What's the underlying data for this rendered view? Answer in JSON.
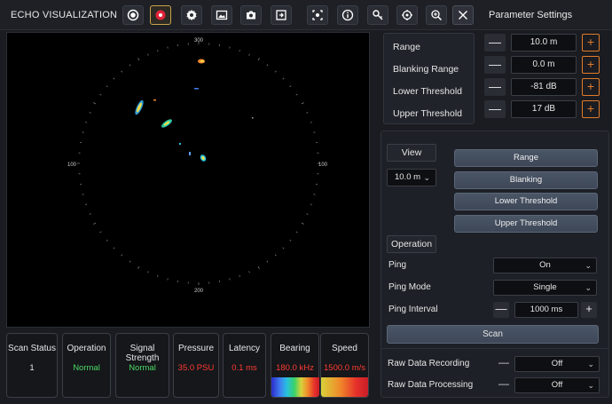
{
  "app": {
    "title": "ECHO VISUALIZATION",
    "parameter_settings_title": "Parameter Settings"
  },
  "toolbar": {
    "icons": [
      "record-circle-icon",
      "record-active-icon",
      "settings-icon",
      "image-icon",
      "camera-icon",
      "export-icon",
      "focus-icon",
      "info-icon",
      "key-icon",
      "target-icon",
      "zoom-icon",
      "close-icon"
    ]
  },
  "radar": {
    "label_top": "300",
    "label_bottom": "200",
    "label_left": "100",
    "label_right": "100"
  },
  "status": {
    "scan_status": {
      "label": "Scan Status",
      "value": "1"
    },
    "operation": {
      "label": "Operation",
      "value": "Normal"
    },
    "signal_strength": {
      "label": "Signal Strength",
      "value": "Normal"
    },
    "pressure": {
      "label": "Pressure",
      "value": "35.0 PSU"
    },
    "latency": {
      "label": "Latency",
      "value": "0.1 ms"
    },
    "bearing": {
      "label": "Bearing",
      "value": "180.0 kHz"
    },
    "speed": {
      "label": "Speed",
      "value": "1500.0 m/s"
    }
  },
  "params": {
    "range": {
      "label": "Range",
      "value": "10.0 m"
    },
    "blanking_range": {
      "label": "Blanking Range",
      "value": "0.0 m"
    },
    "lower_threshold": {
      "label": "Lower Threshold",
      "value": "-81 dB"
    },
    "upper_threshold": {
      "label": "Upper Threshold",
      "value": "17 dB"
    },
    "minus": "—",
    "plus": "+"
  },
  "view": {
    "label": "View",
    "selected": "10.0 m",
    "buttons": [
      "Range",
      "Blanking",
      "Lower Threshold",
      "Upper Threshold"
    ]
  },
  "operation": {
    "label": "Operation",
    "ping": {
      "label": "Ping",
      "value": "On"
    },
    "ping_mode": {
      "label": "Ping Mode",
      "value": "Single"
    },
    "ping_interval": {
      "label": "Ping Interval",
      "value": "1000 ms"
    },
    "scan_label": "Scan"
  },
  "raw": {
    "recording": {
      "label": "Raw Data Recording",
      "value": "Off"
    },
    "processing": {
      "label": "Raw Data Processing",
      "value": "Off"
    },
    "dash": "—"
  },
  "colors": {
    "accent": "#e07b2a",
    "good": "#4cd964",
    "alert": "#ff3b30"
  }
}
